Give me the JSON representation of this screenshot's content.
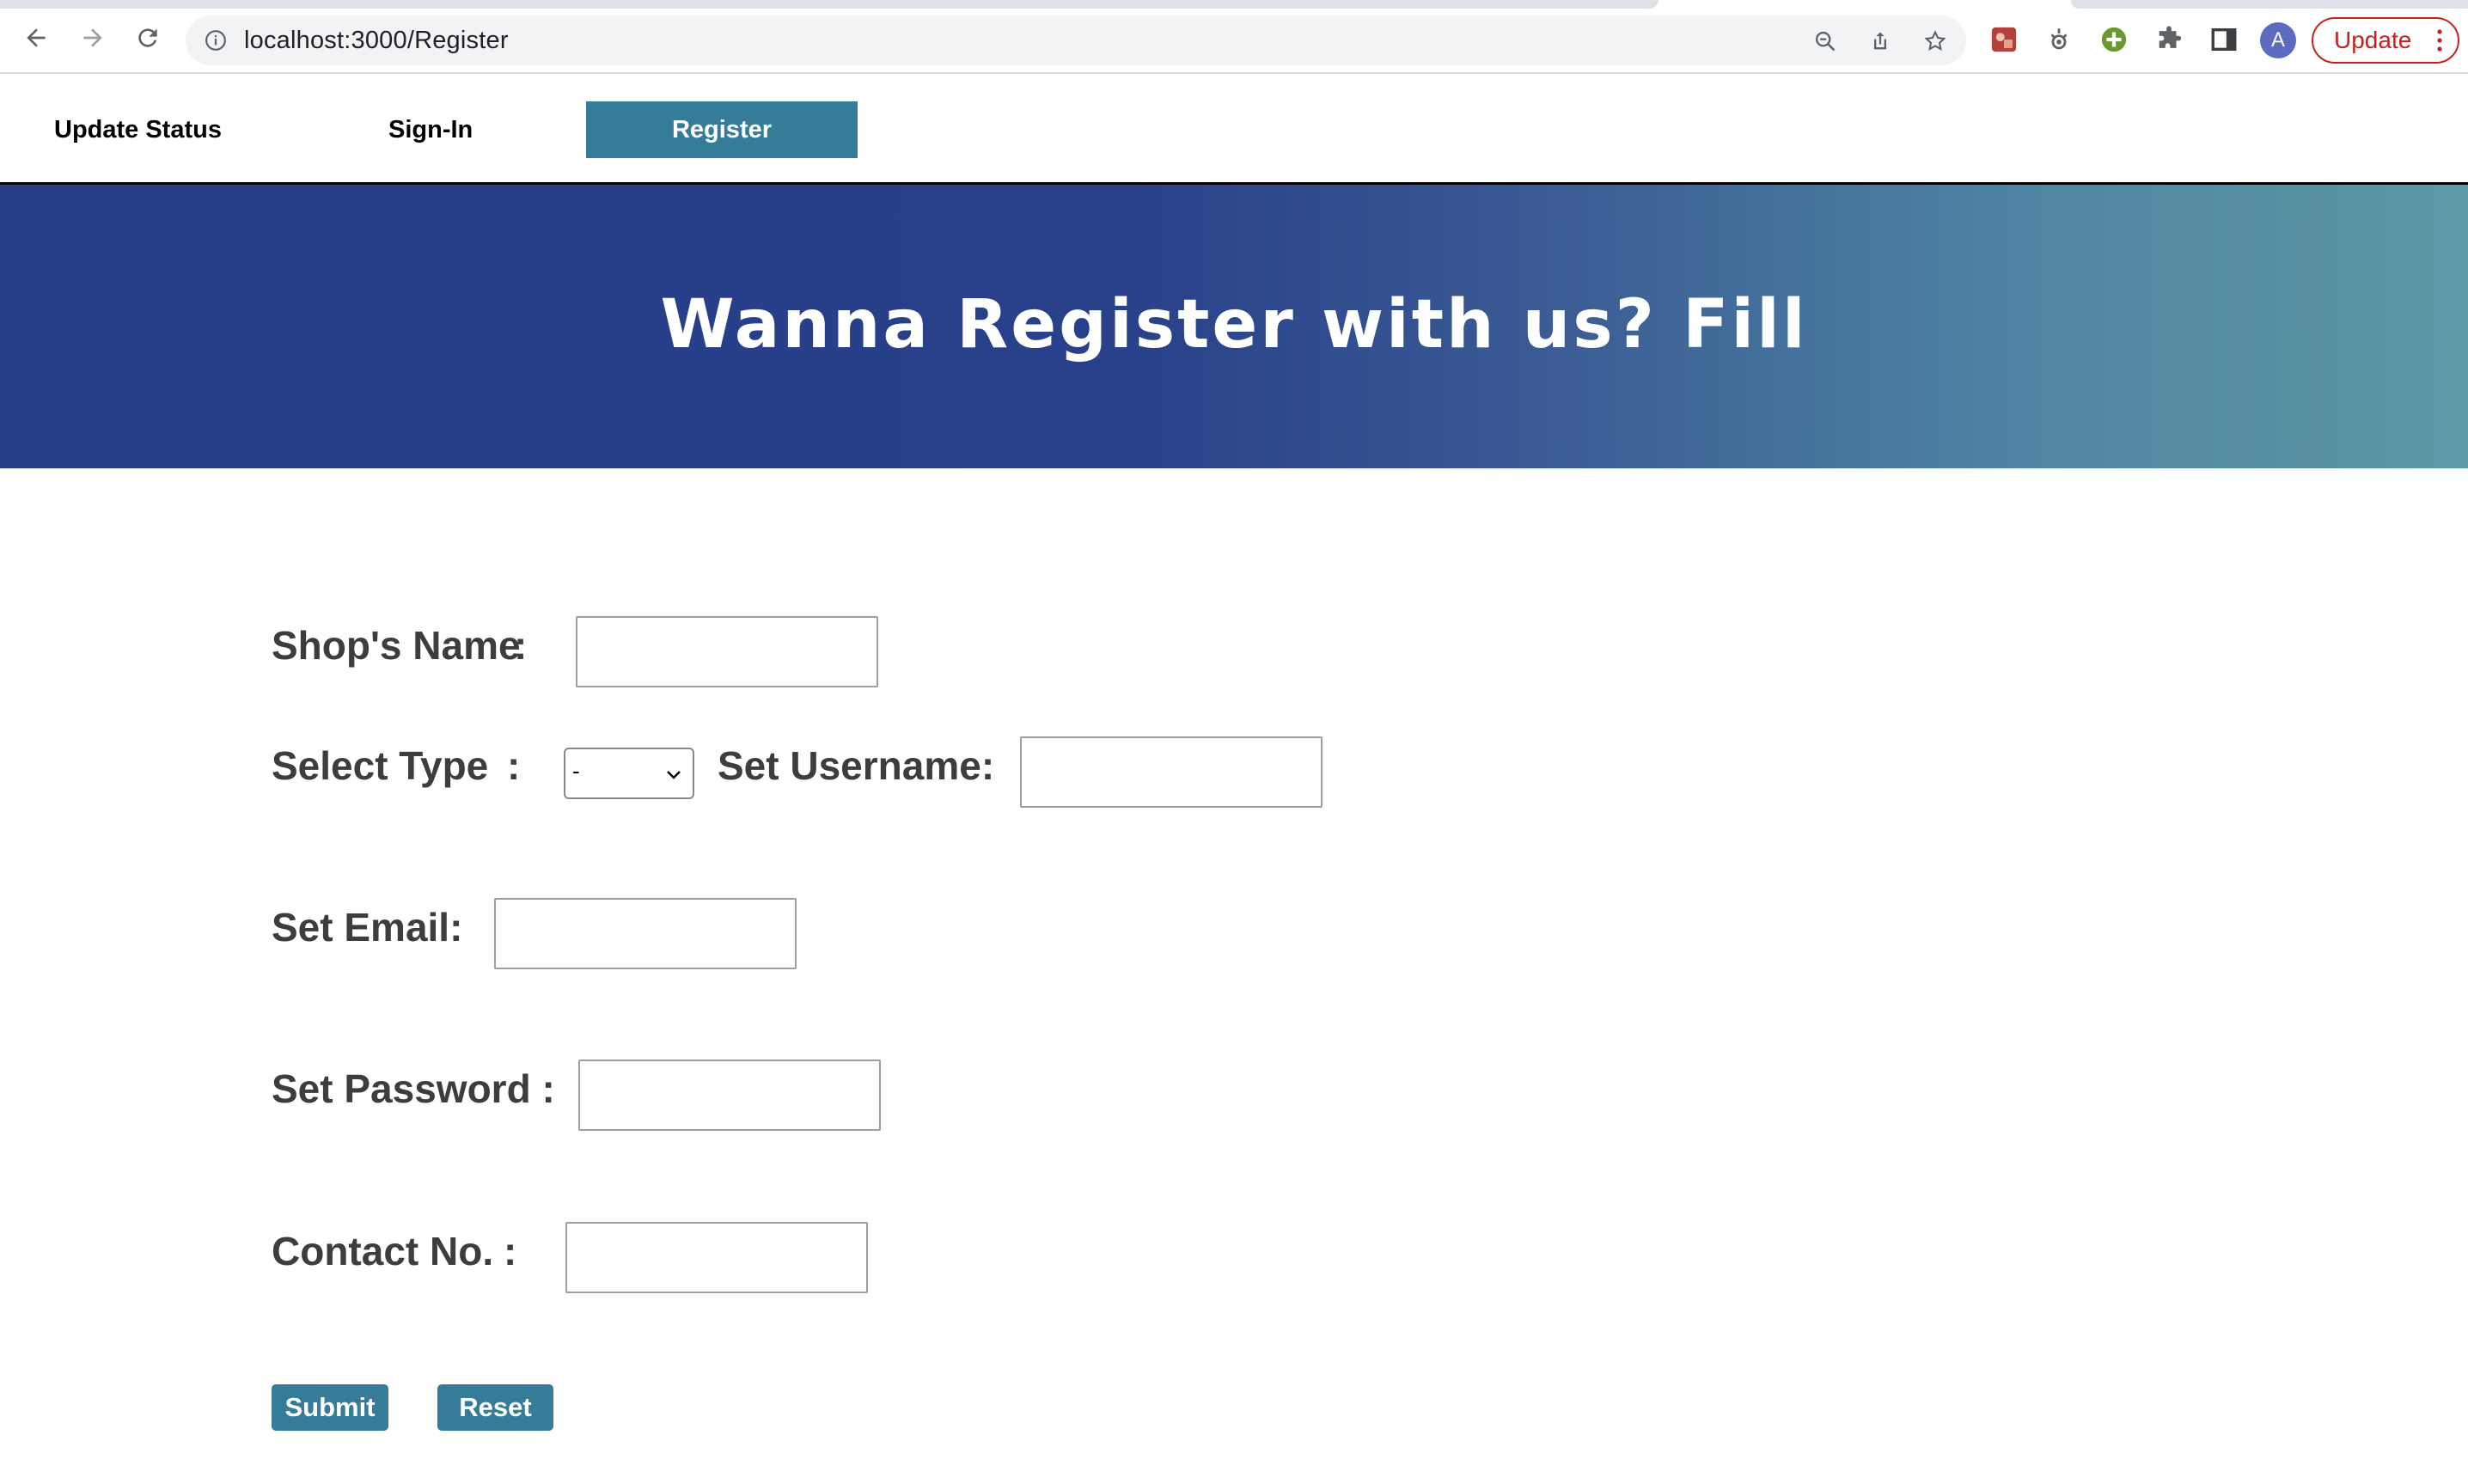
{
  "browser": {
    "url": "localhost:3000/Register",
    "update_label": "Update",
    "profile_initial": "A",
    "icons": [
      "back-icon",
      "forward-icon",
      "reload-icon",
      "site-info-icon",
      "zoom-icon",
      "share-icon",
      "bookmark-star-icon",
      "extension-icon",
      "extension-icon",
      "extension-icon",
      "puzzle-icon",
      "side-panel-icon",
      "menu-dots-icon"
    ]
  },
  "nav": {
    "items": [
      {
        "label": "Update Status"
      },
      {
        "label": "Sign-In"
      },
      {
        "label": "Register",
        "active": true
      }
    ]
  },
  "banner": {
    "title": "Wanna Register with us? Fill"
  },
  "form": {
    "shop_name_label": "Shop's Name",
    "select_type_label": "Select Type",
    "select_type_value": "-",
    "username_label": "Set Username:",
    "email_label": "Set Email:",
    "password_label": "Set Password :",
    "contact_label": "Contact No.",
    "colon": ":",
    "submit_label": "Submit",
    "reset_label": "Reset"
  },
  "colors": {
    "accent": "#357c99",
    "banner_start": "#273f87",
    "banner_end": "#5d99a5",
    "label_text": "#3d3d3d"
  }
}
